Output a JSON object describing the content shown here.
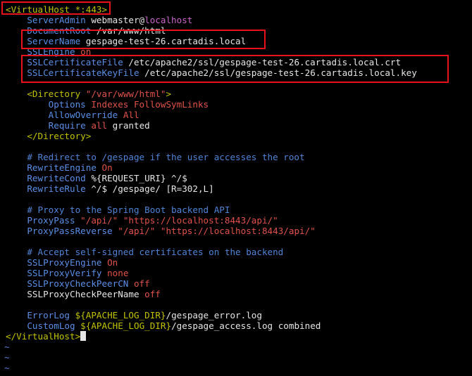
{
  "colors": {
    "background": "#000000",
    "text": "#e6e6e6",
    "directive": "#5a8fe6",
    "tag": "#c2c200",
    "value": "#e0524a",
    "comment": "#4f84d6",
    "highlight_box": "#e8121a",
    "tilde": "#5a7fd6"
  },
  "lines": [
    {
      "tok": [
        {
          "t": "<VirtualHost *:443>",
          "c": "cg"
        }
      ]
    },
    {
      "tok": [
        {
          "t": "    ServerAdmin",
          "c": "cb"
        },
        {
          "t": " webmaster@"
        },
        {
          "t": "localhost",
          "c": "cm"
        }
      ]
    },
    {
      "tok": [
        {
          "t": "    DocumentRoot",
          "c": "cb"
        },
        {
          "t": " /var/www/html"
        }
      ]
    },
    {
      "tok": [
        {
          "t": "    ServerName",
          "c": "cb"
        },
        {
          "t": " gespage-test-26.cartadis.local"
        }
      ]
    },
    {
      "tok": [
        {
          "t": "    SSLEngine",
          "c": "cb"
        },
        {
          "t": " on",
          "c": "cr"
        }
      ]
    },
    {
      "tok": [
        {
          "t": "    SSLCertificateFile",
          "c": "cb"
        },
        {
          "t": " /etc/apache2/ssl/gespage-test-26.cartadis.local.crt"
        }
      ]
    },
    {
      "tok": [
        {
          "t": "    SSLCertificateKeyFile",
          "c": "cb"
        },
        {
          "t": " /etc/apache2/ssl/gespage-test-26.cartadis.local.key"
        }
      ]
    },
    {
      "tok": [
        {
          "t": ""
        }
      ]
    },
    {
      "tok": [
        {
          "t": "    <Directory",
          "c": "cg"
        },
        {
          "t": " \"/var/www/html\"",
          "c": "cr"
        },
        {
          "t": ">",
          "c": "cg"
        }
      ]
    },
    {
      "tok": [
        {
          "t": "        Options",
          "c": "cb"
        },
        {
          "t": " Indexes FollowSymLinks",
          "c": "cr"
        }
      ]
    },
    {
      "tok": [
        {
          "t": "        AllowOverride",
          "c": "cb"
        },
        {
          "t": " All",
          "c": "cr"
        }
      ]
    },
    {
      "tok": [
        {
          "t": "        Require",
          "c": "cb"
        },
        {
          "t": " all",
          "c": "cr"
        },
        {
          "t": " granted"
        }
      ]
    },
    {
      "tok": [
        {
          "t": "    </Directory>",
          "c": "cg"
        }
      ]
    },
    {
      "tok": [
        {
          "t": ""
        }
      ]
    },
    {
      "tok": [
        {
          "t": "    # Redirect to /gespage if the user accesses the root",
          "c": "cc"
        }
      ]
    },
    {
      "tok": [
        {
          "t": "    RewriteEngine",
          "c": "cb"
        },
        {
          "t": " On",
          "c": "cr"
        }
      ]
    },
    {
      "tok": [
        {
          "t": "    RewriteCond",
          "c": "cb"
        },
        {
          "t": " %{REQUEST_URI} ^/$"
        }
      ]
    },
    {
      "tok": [
        {
          "t": "    RewriteRule",
          "c": "cb"
        },
        {
          "t": " ^/$ /gespage/ [R=302,L]"
        }
      ]
    },
    {
      "tok": [
        {
          "t": ""
        }
      ]
    },
    {
      "tok": [
        {
          "t": "    # Proxy to the Spring Boot backend API",
          "c": "cc"
        }
      ]
    },
    {
      "tok": [
        {
          "t": "    ProxyPass",
          "c": "cb"
        },
        {
          "t": " \"/api/\" \"https://localhost:8443/api/\"",
          "c": "cr"
        }
      ]
    },
    {
      "tok": [
        {
          "t": "    ProxyPassReverse",
          "c": "cb"
        },
        {
          "t": " \"/api/\" \"https://localhost:8443/api/\"",
          "c": "cr"
        }
      ]
    },
    {
      "tok": [
        {
          "t": ""
        }
      ]
    },
    {
      "tok": [
        {
          "t": "    # Accept self-signed certificates on the backend",
          "c": "cc"
        }
      ]
    },
    {
      "tok": [
        {
          "t": "    SSLProxyEngine",
          "c": "cb"
        },
        {
          "t": " On",
          "c": "cr"
        }
      ]
    },
    {
      "tok": [
        {
          "t": "    SSLProxyVerify",
          "c": "cb"
        },
        {
          "t": " none",
          "c": "cr"
        }
      ]
    },
    {
      "tok": [
        {
          "t": "    SSLProxyCheckPeerCN",
          "c": "cb"
        },
        {
          "t": " off",
          "c": "cr"
        }
      ]
    },
    {
      "tok": [
        {
          "t": "    SSLProxyCheckPeerName"
        },
        {
          "t": " off",
          "c": "cr"
        }
      ]
    },
    {
      "tok": [
        {
          "t": ""
        }
      ]
    },
    {
      "tok": [
        {
          "t": "    ErrorLog",
          "c": "cb"
        },
        {
          "t": " ${APACHE_LOG_DIR}",
          "c": "cg"
        },
        {
          "t": "/gespage_error.log"
        }
      ]
    },
    {
      "tok": [
        {
          "t": "    CustomLog",
          "c": "cb"
        },
        {
          "t": " ${APACHE_LOG_DIR}",
          "c": "cg"
        },
        {
          "t": "/gespage_access.log combined"
        }
      ]
    },
    {
      "tok": [
        {
          "t": "</VirtualHost>",
          "c": "cg"
        }
      ],
      "cursor": true
    }
  ],
  "tildes": [
    "~",
    "~",
    "~"
  ]
}
